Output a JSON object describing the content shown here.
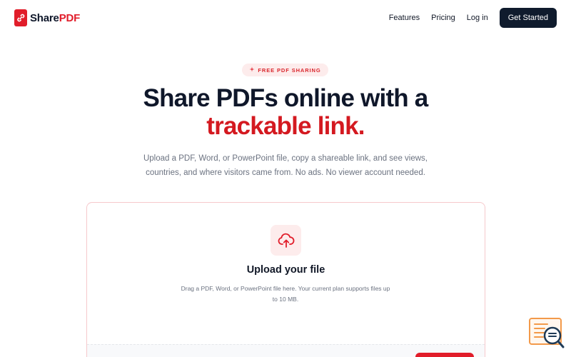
{
  "brand": {
    "name_part1": "Share",
    "name_part2": "PDF",
    "accent_color": "#e11d2a",
    "logo_icon": "link-icon"
  },
  "nav": {
    "items": [
      {
        "label": "Features"
      },
      {
        "label": "Pricing"
      },
      {
        "label": "Log in"
      }
    ],
    "cta_label": "Get Started"
  },
  "hero": {
    "badge_icon": "sparkle-icon",
    "badge_label": "FREE PDF SHARING",
    "title_line1": "Share PDFs online with a",
    "title_line2": "trackable link.",
    "subtitle": "Upload a PDF, Word, or PowerPoint file, copy a shareable link, and see views, countries, and where visitors came from. No ads. No viewer account needed."
  },
  "upload": {
    "icon": "cloud-upload-icon",
    "title": "Upload your file",
    "description": "Drag a PDF, Word, or PowerPoint file here. Your current plan supports files up to 10 MB."
  },
  "widget": {
    "icon": "help-search-icon"
  }
}
